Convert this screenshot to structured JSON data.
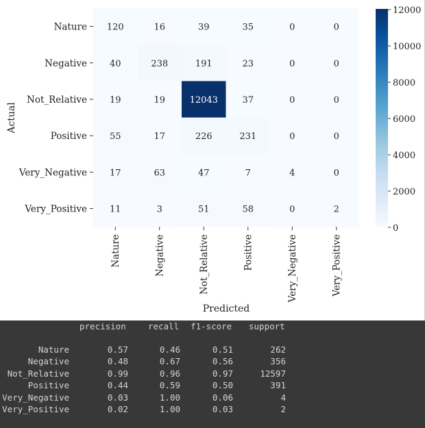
{
  "chart_data": {
    "type": "heatmap",
    "xlabel": "Predicted",
    "ylabel": "Actual",
    "x_categories": [
      "Nature",
      "Negative",
      "Not_Relative",
      "Positive",
      "Very_Negative",
      "Very_Positive"
    ],
    "y_categories": [
      "Nature",
      "Negative",
      "Not_Relative",
      "Positive",
      "Very_Negative",
      "Very_Positive"
    ],
    "values": [
      [
        120,
        16,
        39,
        35,
        0,
        0
      ],
      [
        40,
        238,
        191,
        23,
        0,
        0
      ],
      [
        19,
        19,
        12043,
        37,
        0,
        0
      ],
      [
        55,
        17,
        226,
        231,
        0,
        0
      ],
      [
        17,
        63,
        47,
        7,
        4,
        0
      ],
      [
        11,
        3,
        51,
        58,
        0,
        2
      ]
    ],
    "colorbar": {
      "range": [
        0,
        12043
      ],
      "ticks": [
        0,
        2000,
        4000,
        6000,
        8000,
        10000,
        12000
      ],
      "colormap": "Blues",
      "low_color": "#f7fbff",
      "high_color": "#08306b"
    }
  },
  "report": {
    "headers": [
      "precision",
      "recall",
      "f1-score",
      "support"
    ],
    "rows": [
      {
        "label": "Nature",
        "precision": "0.57",
        "recall": "0.46",
        "f1": "0.51",
        "support": "262"
      },
      {
        "label": "Negative",
        "precision": "0.48",
        "recall": "0.67",
        "f1": "0.56",
        "support": "356"
      },
      {
        "label": "Not_Relative",
        "precision": "0.99",
        "recall": "0.96",
        "f1": "0.97",
        "support": "12597"
      },
      {
        "label": "Positive",
        "precision": "0.44",
        "recall": "0.59",
        "f1": "0.50",
        "support": "391"
      },
      {
        "label": "Very_Negative",
        "precision": "0.03",
        "recall": "1.00",
        "f1": "0.06",
        "support": "4"
      },
      {
        "label": "Very_Positive",
        "precision": "0.02",
        "recall": "1.00",
        "f1": "0.03",
        "support": "2"
      }
    ]
  }
}
